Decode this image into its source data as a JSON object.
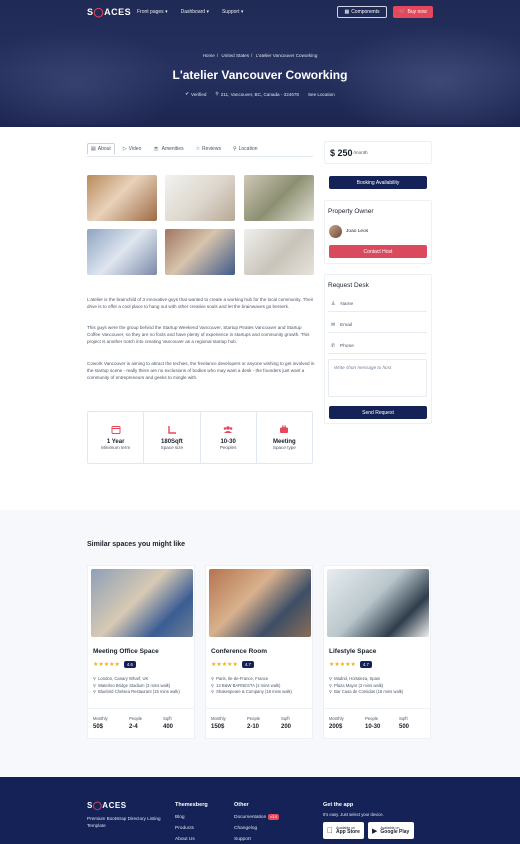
{
  "nav": {
    "logo_pre": "S",
    "logo_mid": "ACES",
    "links": [
      "Front pages",
      "Dashboard",
      "Support"
    ],
    "components": "Components",
    "buy": "Buy now"
  },
  "hero": {
    "breadcrumbs": [
      "Home",
      "United States",
      "L'atelier Vancouver Coworking"
    ],
    "title": "L'atelier Vancouver Coworking",
    "verified": "Verified",
    "address": "211, Vancouver, BC, Canada - 324678",
    "see_location": "See Location"
  },
  "tabs": [
    "About",
    "Video",
    "Amenities",
    "Reviews",
    "Location"
  ],
  "description": [
    "L'atelier is the brainchild of 3 innovative guys that wanted to create a working hub for the local community. Their drive is to offer a cool place to hang out with other creative souls and let the brainwaves go berserk.",
    "This guys were the group behind the Startup Weekend Vancouver, Startup Pirates Vancouver and Startup Coffee Vancouver, so they are no fools and have plenty of experience in startups and community growth. This project is another notch into creating Vancouver as a regional startup hub.",
    "Cowork Vancouver is aiming to attract the techies, the freelance developers or anyone wishing to get involved in the startup scene - really there are no exclusions of bodies who may want a desk - the founders just want a community of entrepreneurs and geeks to mingle with."
  ],
  "stats": [
    {
      "value": "1 Year",
      "label": "Minimum term"
    },
    {
      "value": "180Sqft",
      "label": "Space size"
    },
    {
      "value": "10-30",
      "label": "Peoples"
    },
    {
      "value": "Meeting",
      "label": "Space type"
    }
  ],
  "sidebar": {
    "price": "$ 250",
    "per": "/month",
    "booking": "Booking Availability",
    "owner_heading": "Property Owner",
    "owner_name": "Joao Leos",
    "contact": "Contact Host",
    "request_heading": "Request Desk",
    "name_ph": "Name",
    "email_ph": "Email",
    "phone_ph": "Phone",
    "message_ph": "Write short message to host",
    "send": "Send Request"
  },
  "similar": {
    "heading": "Similar spaces you might like",
    "cards": [
      {
        "name": "Meeting Office Space",
        "rating": "4.6",
        "addr": [
          "London, Canary Wharf, UK",
          "Waterloo Bridge Stadium (3 mins walk)",
          "Bluebird Chelsea Restaurant (15 mins walk)"
        ],
        "cols": [
          [
            "Monthly",
            "50$"
          ],
          [
            "People",
            "2-4"
          ],
          [
            "Sq/ft",
            "400"
          ]
        ]
      },
      {
        "name": "Conference Room",
        "rating": "4.7",
        "addr": [
          "Paris, Ile-de-France, France",
          "13 B&W BARNESTA (2 mins walk)",
          "Shakespeare & Company (18 mins walk)"
        ],
        "cols": [
          [
            "Monthly",
            "150$"
          ],
          [
            "People",
            "2-10"
          ],
          [
            "Sq/ft",
            "200"
          ]
        ]
      },
      {
        "name": "Lifestyle Space",
        "rating": "4.7",
        "addr": [
          "Madrid, Hortaleza, Spain",
          "Plaza Mayor (3 mins walk)",
          "Bar Casa de Comidas (18 mins walk)"
        ],
        "cols": [
          [
            "Monthly",
            "200$"
          ],
          [
            "People",
            "10-30"
          ],
          [
            "Sq/ft",
            "500"
          ]
        ]
      }
    ]
  },
  "footer": {
    "tagline": "Premium Bootstrap Directory Listing Template",
    "col1_head": "Themesberg",
    "col1": [
      "Blog",
      "Products",
      "About Us"
    ],
    "col2_head": "Other",
    "col2": [
      "Documentation",
      "Changelog",
      "Support"
    ],
    "new_badge": "v3.0",
    "app_head": "Get the app",
    "app_sub": "It's easy. Just select your device.",
    "appstore_small": "Available on",
    "appstore": "App Store",
    "gplay_small": "Available on",
    "gplay": "Google Play"
  },
  "colors": {
    "accent": "#e5485b",
    "navy": "#142257",
    "star": "#f5b301"
  }
}
